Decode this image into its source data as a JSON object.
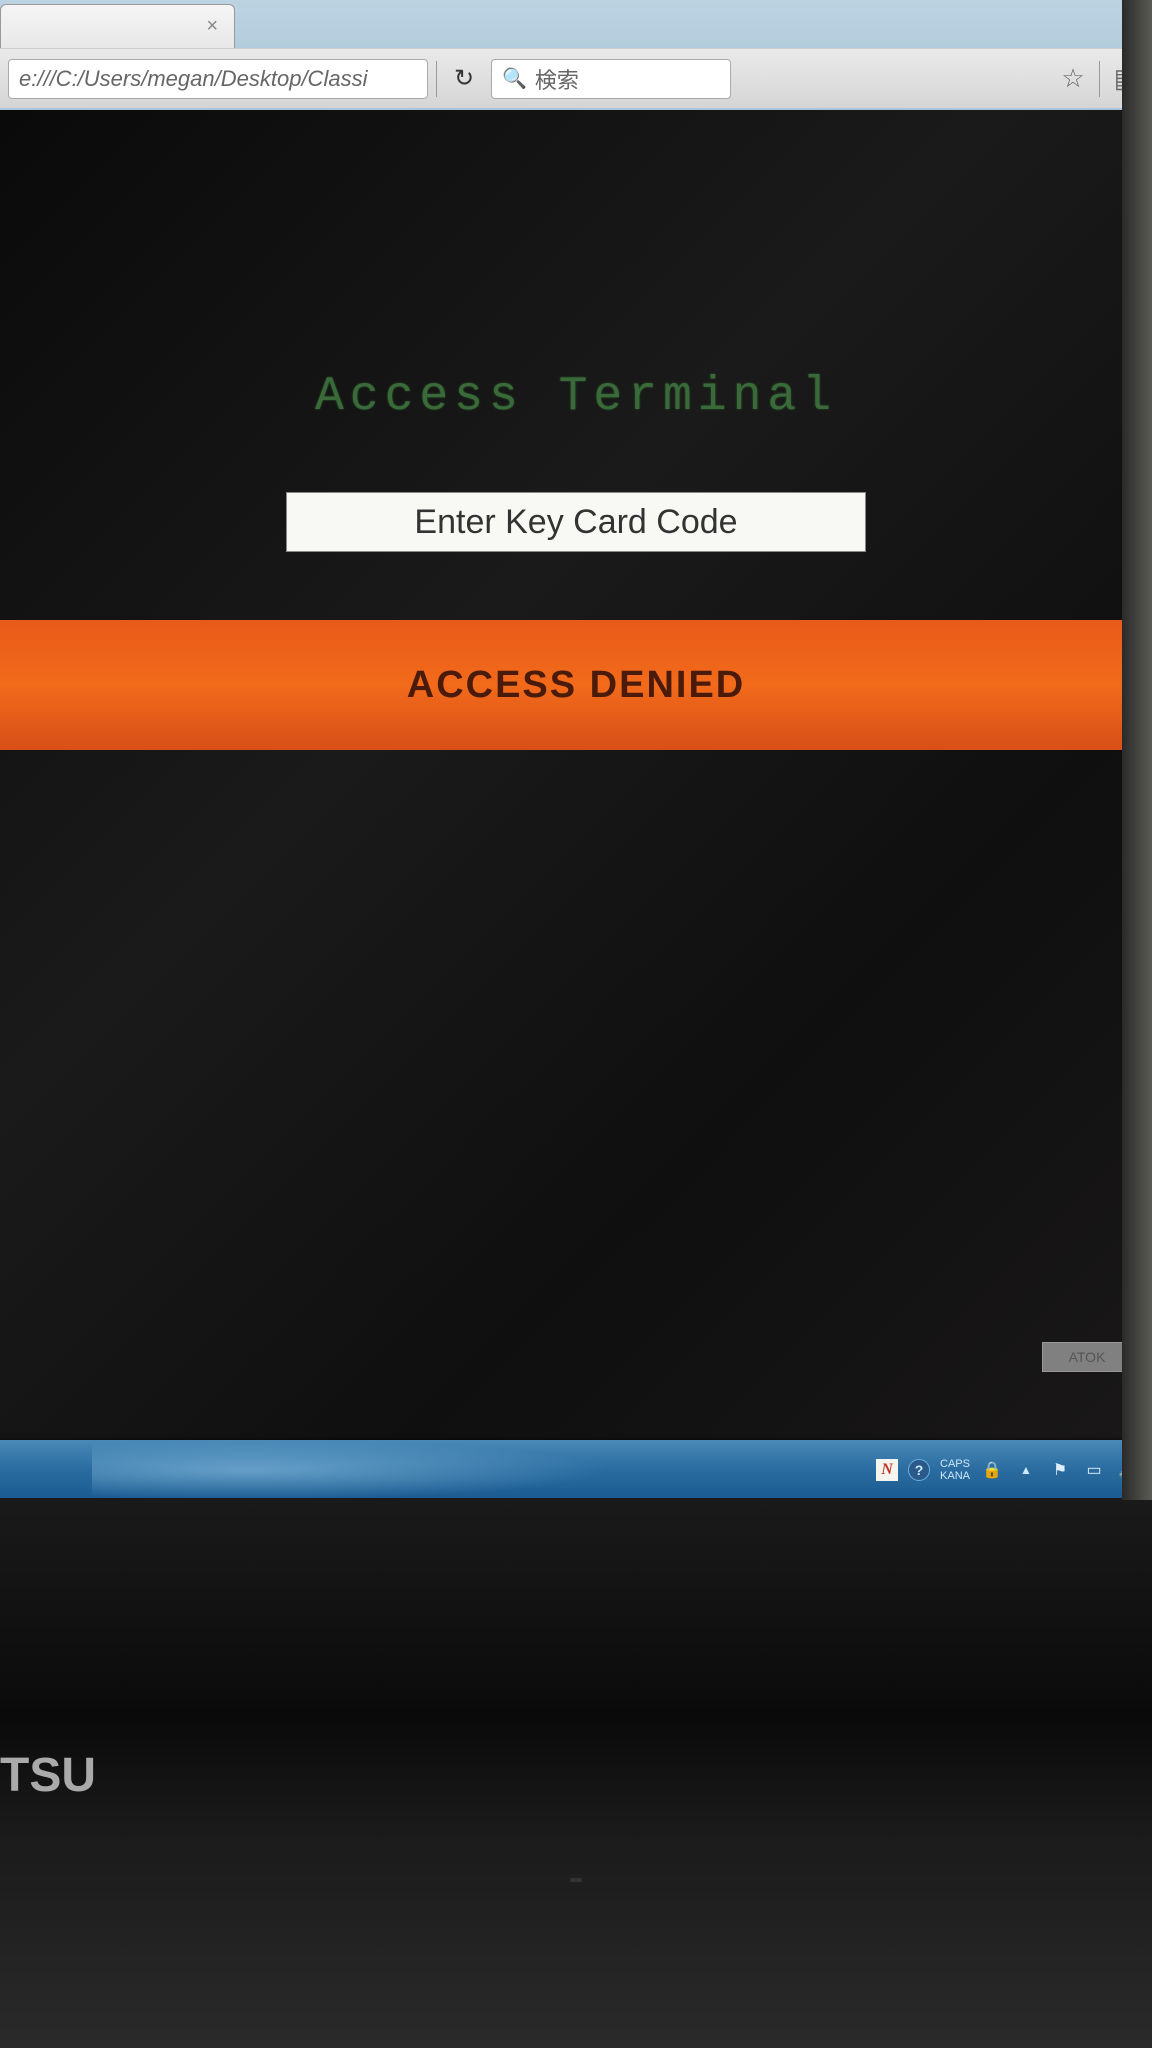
{
  "browser": {
    "url_display": "e:///C:/Users/megan/Desktop/Classi",
    "search_placeholder": "検索",
    "tab_close_glyph": "×",
    "reload_glyph": "↻",
    "search_icon_glyph": "🔍",
    "star_glyph": "☆",
    "list_glyph": "▤"
  },
  "page": {
    "terminal_title": "Access Terminal",
    "input_placeholder": "Enter Key Card Code",
    "status_message": "ACCESS DENIED",
    "ime_label": "ATOK"
  },
  "taskbar": {
    "n_label": "N",
    "help_label": "?",
    "caps_label": "CAPS",
    "kana_label": "KANA",
    "lock_glyph": "🔒",
    "chevron_glyph": "▲",
    "flag_glyph": "⚑",
    "device_glyph": "▭",
    "volume_glyph": "🔊"
  },
  "laptop": {
    "brand_fragment": "TSU"
  },
  "colors": {
    "banner_bg": "#ea5a1a",
    "terminal_green": "#3a6a3a",
    "taskbar_blue": "#2a6ca0"
  }
}
